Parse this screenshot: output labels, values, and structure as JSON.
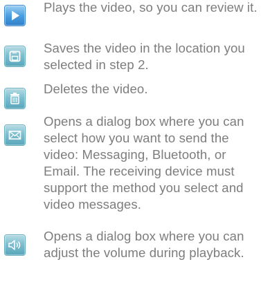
{
  "colors": {
    "text": "#7d7d7d",
    "icon_bg": "#7fbfcf",
    "play_icon_bg": "#4c9fe0"
  },
  "items": [
    {
      "icon": "play-icon",
      "text": "Plays the video, so you can review it."
    },
    {
      "icon": "save-icon",
      "text": "Saves the video in the location you selected in step 2."
    },
    {
      "icon": "delete-icon",
      "text": "Deletes the video."
    },
    {
      "icon": "send-icon",
      "text": "Opens a dialog box where you can select how you want to send the video: Messaging, Bluetooth, or Email. The receiving device must support the method you select and video messages."
    },
    {
      "icon": "volume-icon",
      "text": "Opens a dialog box where you can adjust the volume during playback."
    }
  ]
}
